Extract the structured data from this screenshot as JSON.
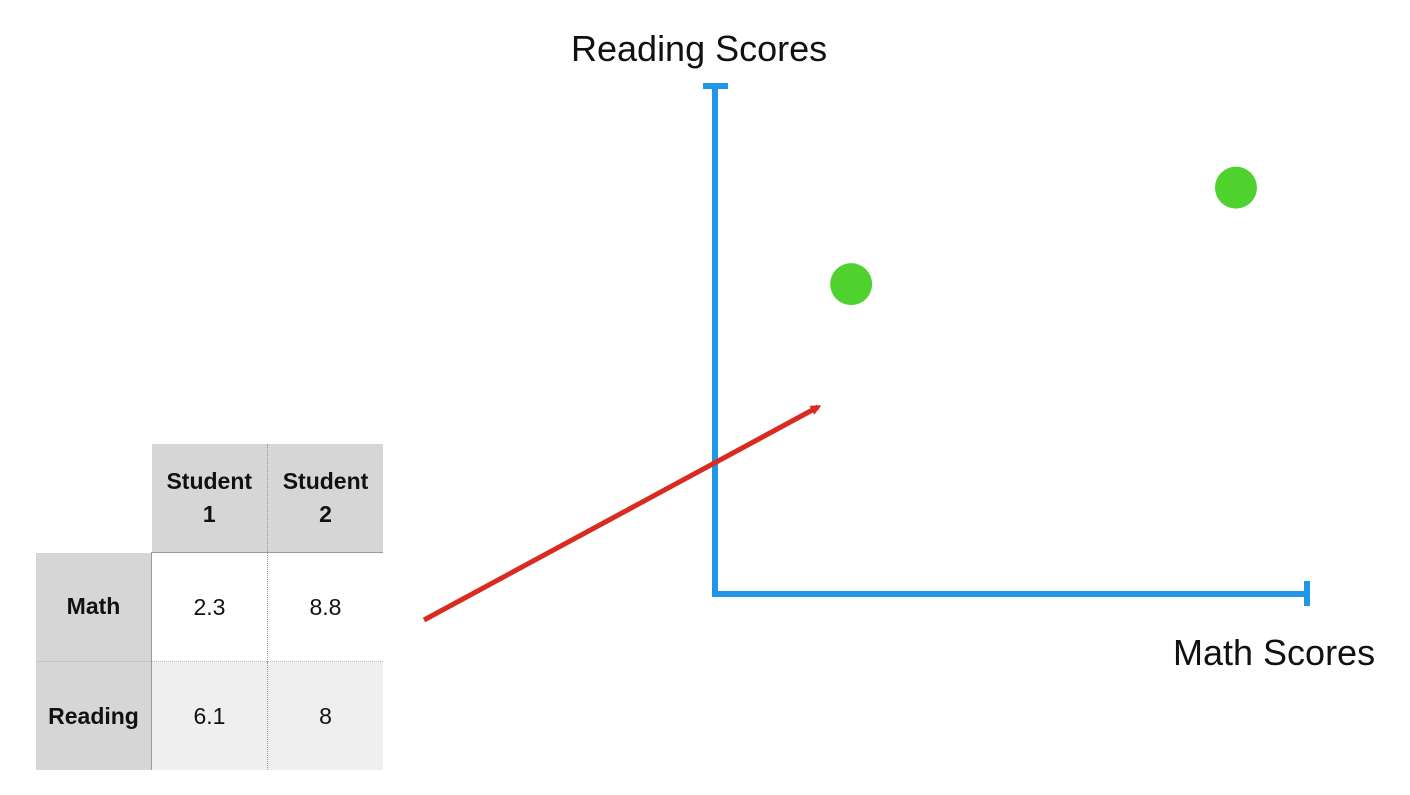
{
  "chart_data": {
    "type": "scatter",
    "xlabel": "Math Scores",
    "ylabel": "Reading Scores",
    "xlim": [
      0,
      10
    ],
    "ylim": [
      0,
      10
    ],
    "grid": false,
    "points": [
      {
        "x": 2.3,
        "y": 6.1
      },
      {
        "x": 8.8,
        "y": 8.0
      }
    ],
    "colors": {
      "axis": "#1f96e8",
      "point": "#4fd12e",
      "arrow": "#d92b20"
    }
  },
  "table": {
    "corner": "",
    "columns": [
      "Student 1",
      "Student 2"
    ],
    "rows": [
      {
        "label": "Math",
        "values": [
          "2.3",
          "8.8"
        ]
      },
      {
        "label": "Reading",
        "values": [
          "6.1",
          "8"
        ]
      }
    ]
  },
  "annotation": {
    "arrow": "from Student 1 column to Student 1 point"
  }
}
